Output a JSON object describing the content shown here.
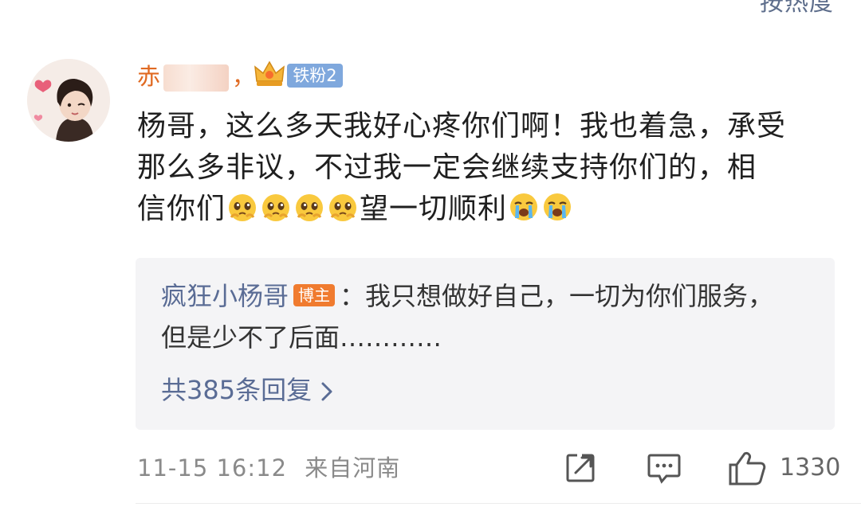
{
  "sort_label": "按热度",
  "comment": {
    "username": "赤",
    "username_suffix": "，",
    "fan_badge": "铁粉2",
    "text_lines": [
      "杨哥，这么多天我好心疼你们啊！我也着急，承受",
      "那么多非议，不过我一定会继续支持你们的，相"
    ],
    "line3_start": "信你们",
    "line3_middle": "望一切顺利",
    "emojis": [
      "pleading-face-icon",
      "pleading-face-icon",
      "pleading-face-icon",
      "pleading-face-icon",
      "crying-face-icon",
      "crying-face-icon"
    ],
    "time": "11-15 16:12",
    "location": "来自河南",
    "like_count": "1330"
  },
  "reply": {
    "author": "疯狂小杨哥",
    "badge": "博主",
    "text_line1": "：我只想做好自己，一切为你们服务，",
    "text_line2": "但是少不了后面…………",
    "count_label": "共385条回复"
  },
  "colors": {
    "username": "#e06a22",
    "link": "#5a6c95",
    "fan_badge": "#7fa8dd",
    "blogger_badge": "#f07b2f",
    "reply_bg": "#f4f4f6"
  }
}
